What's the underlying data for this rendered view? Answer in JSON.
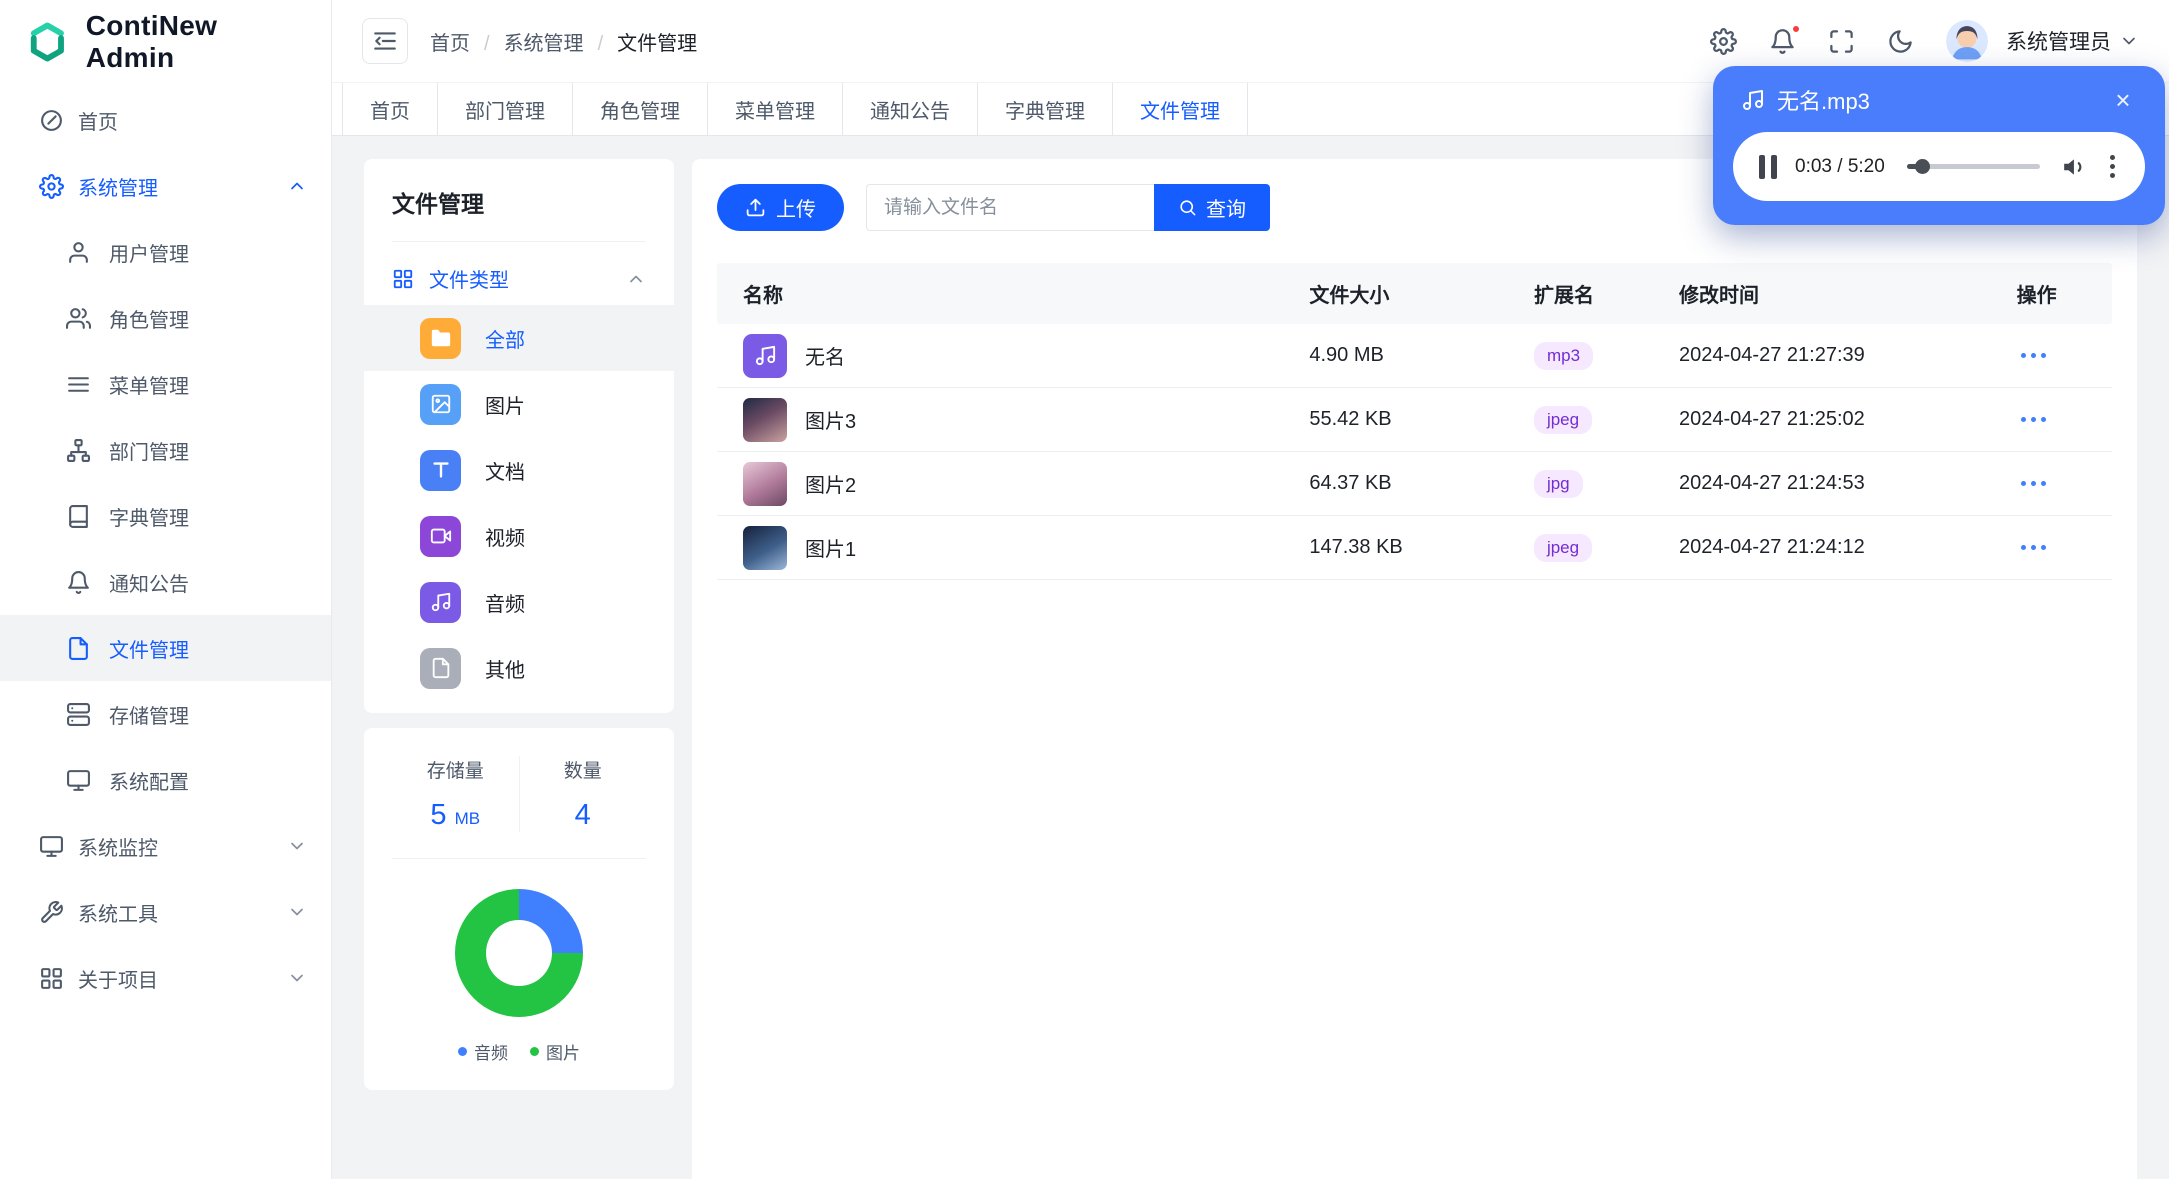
{
  "app": {
    "title": "ContiNew Admin"
  },
  "header": {
    "breadcrumb": [
      "首页",
      "系统管理",
      "文件管理"
    ],
    "username": "系统管理员"
  },
  "sidebar": {
    "home": "首页",
    "system": "系统管理",
    "sub": [
      "用户管理",
      "角色管理",
      "菜单管理",
      "部门管理",
      "字典管理",
      "通知公告",
      "文件管理",
      "存储管理",
      "系统配置"
    ],
    "groups": [
      "系统监控",
      "系统工具",
      "关于项目"
    ],
    "active": "文件管理"
  },
  "tabs": [
    "首页",
    "部门管理",
    "角色管理",
    "菜单管理",
    "通知公告",
    "字典管理",
    "文件管理"
  ],
  "tabs_active": "文件管理",
  "filter": {
    "title": "文件管理",
    "group": "文件类型",
    "types": [
      "全部",
      "图片",
      "文档",
      "视频",
      "音频",
      "其他"
    ],
    "active_type": "全部"
  },
  "stats": {
    "storage_label": "存储量",
    "storage_value": "5",
    "storage_unit": "MB",
    "count_label": "数量",
    "count_value": "4"
  },
  "chart_data": {
    "type": "pie",
    "labels": [
      "音频",
      "图片"
    ],
    "values": [
      1,
      3
    ],
    "colors": [
      "#4080ff",
      "#23c343"
    ],
    "title": "",
    "legend_position": "bottom"
  },
  "toolbar": {
    "upload": "上传",
    "search_placeholder": "请输入文件名",
    "query": "查询"
  },
  "table": {
    "columns": [
      "名称",
      "文件大小",
      "扩展名",
      "修改时间",
      "操作"
    ],
    "rows": [
      {
        "name": "无名",
        "size": "4.90 MB",
        "ext": "mp3",
        "time": "2024-04-27 21:27:39",
        "kind": "audio"
      },
      {
        "name": "图片3",
        "size": "55.42 KB",
        "ext": "jpeg",
        "time": "2024-04-27 21:25:02",
        "kind": "image"
      },
      {
        "name": "图片2",
        "size": "64.37 KB",
        "ext": "jpg",
        "time": "2024-04-27 21:24:53",
        "kind": "image"
      },
      {
        "name": "图片1",
        "size": "147.38 KB",
        "ext": "jpeg",
        "time": "2024-04-27 21:24:12",
        "kind": "image"
      }
    ]
  },
  "player": {
    "title": "无名.mp3",
    "time": "0:03 / 5:20"
  },
  "colors": {
    "primary": "#165dff",
    "tag_bg": "#f5e8ff",
    "tag_text": "#722ed1",
    "player_bg": "#4a7dfb"
  }
}
